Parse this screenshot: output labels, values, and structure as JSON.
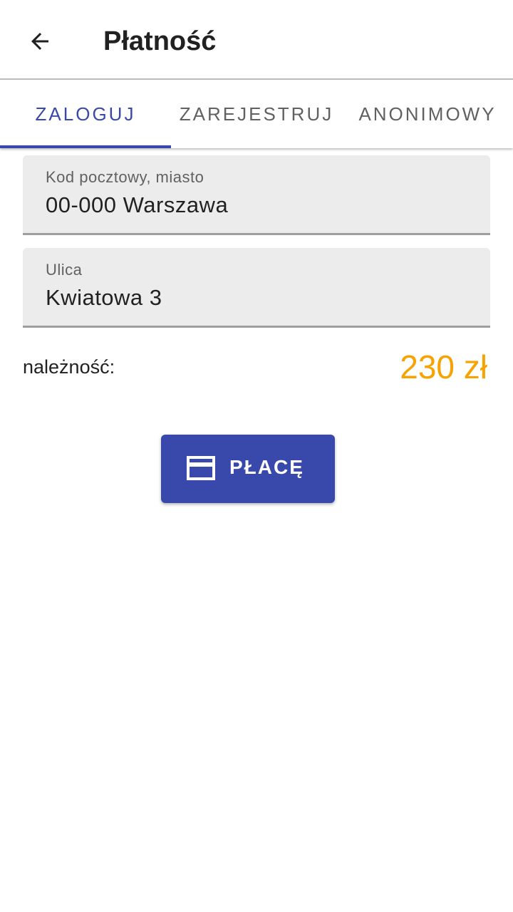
{
  "appbar": {
    "back_icon": "arrow-back-icon",
    "title": "Płatność"
  },
  "tabs": [
    {
      "label": "ZALOGUJ",
      "active": true
    },
    {
      "label": "ZAREJESTRUJ",
      "active": false
    },
    {
      "label": "ANONIMOWY",
      "active": false
    }
  ],
  "form": {
    "postal_city": {
      "label": "Kod pocztowy, miasto",
      "value": "00-000 Warszawa"
    },
    "street": {
      "label": "Ulica",
      "value": "Kwiatowa 3"
    }
  },
  "summary": {
    "due_label": "należność:",
    "due_amount": "230 zł"
  },
  "pay_button": {
    "icon": "credit-card-icon",
    "label": "PŁACĘ"
  },
  "colors": {
    "primary": "#3949ab",
    "amount": "#f6a200",
    "field_bg": "#ececec"
  }
}
